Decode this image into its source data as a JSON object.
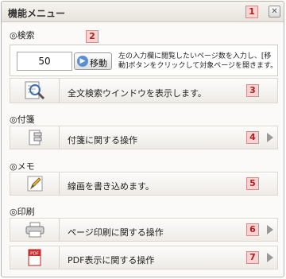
{
  "window": {
    "title": "機能メニュー",
    "title_badge": "1",
    "close_symbol": "✕"
  },
  "search": {
    "section_label": "◎検索",
    "badge": "2",
    "page_value": "50",
    "move_button_label": "移動",
    "help_text": "左の入力欄に閲覧したいページ数を入力し、[移動]ボタンをクリックして対象ページを開きます。"
  },
  "fulltext": {
    "label": "全文検索ウインドウを表示します。",
    "badge": "3",
    "icon": "magnifier-icon"
  },
  "sticky": {
    "section_label": "◎付箋",
    "label": "付箋に関する操作",
    "badge": "4",
    "icon": "sticky-note-icon"
  },
  "memo": {
    "section_label": "◎メモ",
    "label": "線画を書き込めます。",
    "badge": "5",
    "icon": "pencil-icon"
  },
  "print": {
    "section_label": "◎印刷",
    "page_print_label": "ページ印刷に関する操作",
    "page_print_badge": "6",
    "page_print_icon": "printer-icon",
    "pdf_label": "PDF表示に関する操作",
    "pdf_badge": "7",
    "pdf_icon": "pdf-icon",
    "pdf_icon_text": "PDF"
  },
  "colors": {
    "badge_bg": "#f7d3d3",
    "badge_text": "#b01f1f",
    "accent_blue": "#5b8fd4"
  }
}
